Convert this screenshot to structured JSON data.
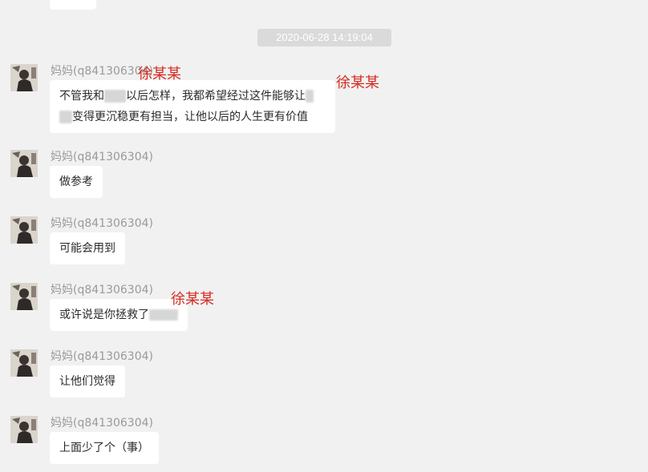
{
  "timestamp": "2020-06-28 14:19:04",
  "sender_name": "妈妈(q841306304)",
  "annotation": "徐某某",
  "messages": [
    {
      "lines": [
        [
          "不管我和",
          "",
          "以后怎样，我都希望经过这件能够让",
          ""
        ],
        [
          "",
          "变得更沉稳更有担当，让他以后的人生更有价值"
        ]
      ]
    },
    {
      "lines": [
        [
          "做参考"
        ]
      ]
    },
    {
      "lines": [
        [
          "可能会用到"
        ]
      ]
    },
    {
      "lines": [
        [
          "或许说是你拯救了",
          ""
        ]
      ]
    },
    {
      "lines": [
        [
          "让他们觉得"
        ]
      ]
    },
    {
      "lines": [
        [
          "上面少了个（事）"
        ]
      ]
    }
  ],
  "icons": {
    "avatar": "avatar-photo-icon"
  },
  "colors": {
    "background": "#f1f1f1",
    "bubble": "#ffffff",
    "annotation": "#d62a22",
    "sender": "#9a9a9a",
    "timestamp_bg": "#dadada"
  }
}
